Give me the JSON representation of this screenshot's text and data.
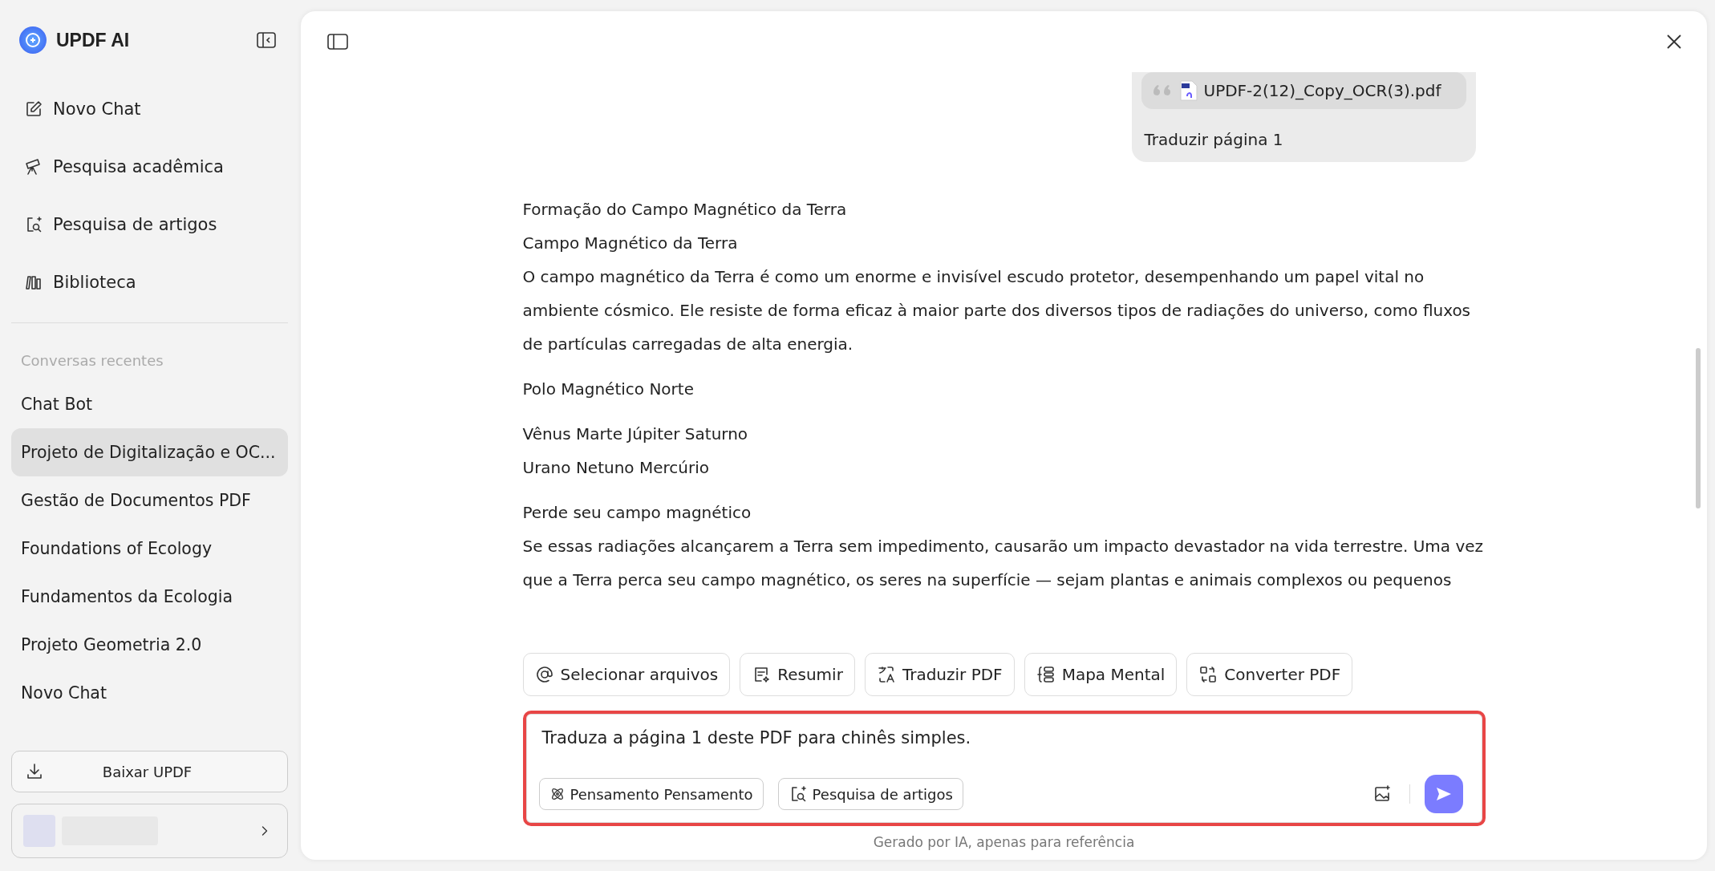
{
  "sidebar": {
    "brand": "UPDF AI",
    "nav": [
      {
        "label": "Novo Chat"
      },
      {
        "label": "Pesquisa acadêmica"
      },
      {
        "label": "Pesquisa de artigos"
      },
      {
        "label": "Biblioteca"
      }
    ],
    "recent_heading": "Conversas recentes",
    "recent": [
      {
        "title": "Chat Bot",
        "selected": false
      },
      {
        "title": "Projeto de Digitalização e OC...",
        "selected": true
      },
      {
        "title": "Gestão de Documentos PDF",
        "selected": false
      },
      {
        "title": "Foundations of Ecology",
        "selected": false
      },
      {
        "title": "Fundamentos da Ecologia",
        "selected": false
      },
      {
        "title": "Projeto Geometria 2.0",
        "selected": false
      },
      {
        "title": "Novo Chat",
        "selected": false
      }
    ],
    "download_button": "Baixar UPDF"
  },
  "chat": {
    "user_message": {
      "attachment": "UPDF-2(12)_Copy_OCR(3).pdf",
      "text": "Traduzir página 1"
    },
    "answer": [
      [
        "Formação do Campo Magnético da Terra",
        "Campo Magnético da Terra",
        "O campo magnético da Terra é como um enorme e invisível escudo protetor, desempenhando um papel vital no ambiente cósmico. Ele resiste de forma eficaz à maior parte dos diversos tipos de radiações do universo, como fluxos de partículas carregadas de alta energia."
      ],
      [
        "Polo Magnético Norte"
      ],
      [
        "Vênus Marte Júpiter Saturno",
        "Urano Netuno Mercúrio"
      ],
      [
        "Perde seu campo magnético",
        "Se essas radiações alcançarem a Terra sem impedimento, causarão um impacto devastador na vida terrestre. Uma vez que a Terra perca seu campo magnético, os seres na superfície — sejam plantas e animais complexos ou pequenos"
      ]
    ],
    "tools": [
      {
        "label": "Selecionar arquivos"
      },
      {
        "label": "Resumir"
      },
      {
        "label": "Traduzir PDF"
      },
      {
        "label": "Mapa Mental"
      },
      {
        "label": "Converter PDF"
      }
    ],
    "input": {
      "value": "Traduza a página 1 deste PDF para chinês simples.",
      "options": [
        {
          "label": "Pensamento Pensamento"
        },
        {
          "label": "Pesquisa de artigos"
        }
      ]
    },
    "footer": "Gerado por IA, apenas para referência"
  }
}
